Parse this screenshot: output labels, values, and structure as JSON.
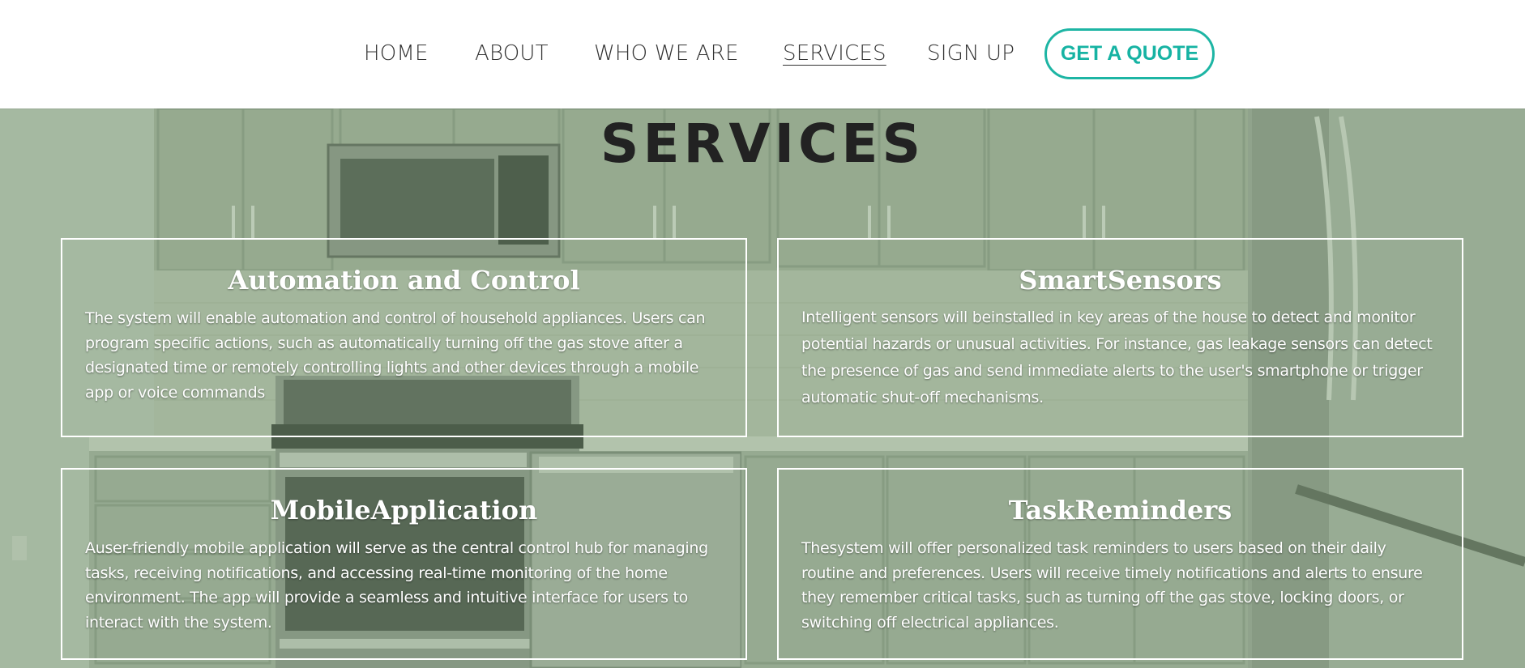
{
  "nav": {
    "items": [
      {
        "label": "HOME",
        "active": false
      },
      {
        "label": "ABOUT",
        "active": false
      },
      {
        "label": "WHO WE ARE",
        "active": false
      },
      {
        "label": "SERVICES",
        "active": true
      },
      {
        "label": "SIGN UP",
        "active": false
      }
    ],
    "cta_label": "GET A QUOTE"
  },
  "colors": {
    "accent": "#1db5a4",
    "nav_text": "#333333",
    "title_text": "#222222",
    "card_text": "#ffffff"
  },
  "section": {
    "title": "SERVICES"
  },
  "cards": [
    {
      "title": "Automation and Control",
      "body": "The system will enable automation and control of household appliances. Users can program specific actions, such as automatically turning off the gas stove after a designated time or remotely controlling lights and other devices through a  mobile app or voice commands"
    },
    {
      "title": "SmartSensors",
      "body": " Intelligent sensors will beinstalled in key areas of the house to detect and monitor potential hazards or unusual activities. For instance, gas leakage sensors can detect the presence of gas and send immediate alerts to the user's smartphone or trigger automatic shut-off mechanisms."
    },
    {
      "title": "MobileApplication",
      "body": "Auser-friendly mobile application will serve as the central control hub for managing tasks, receiving notifications, and accessing real-time monitoring of the home environment. The app will provide a seamless and intuitive interface for users to interact with the system."
    },
    {
      "title": "TaskReminders",
      "body": "Thesystem will offer personalized task reminders to users based on their daily routine and preferences. Users will receive timely notifications and alerts to  ensure they remember critical tasks, such as turning off the gas stove, locking doors, or switching off electrical appliances."
    }
  ]
}
